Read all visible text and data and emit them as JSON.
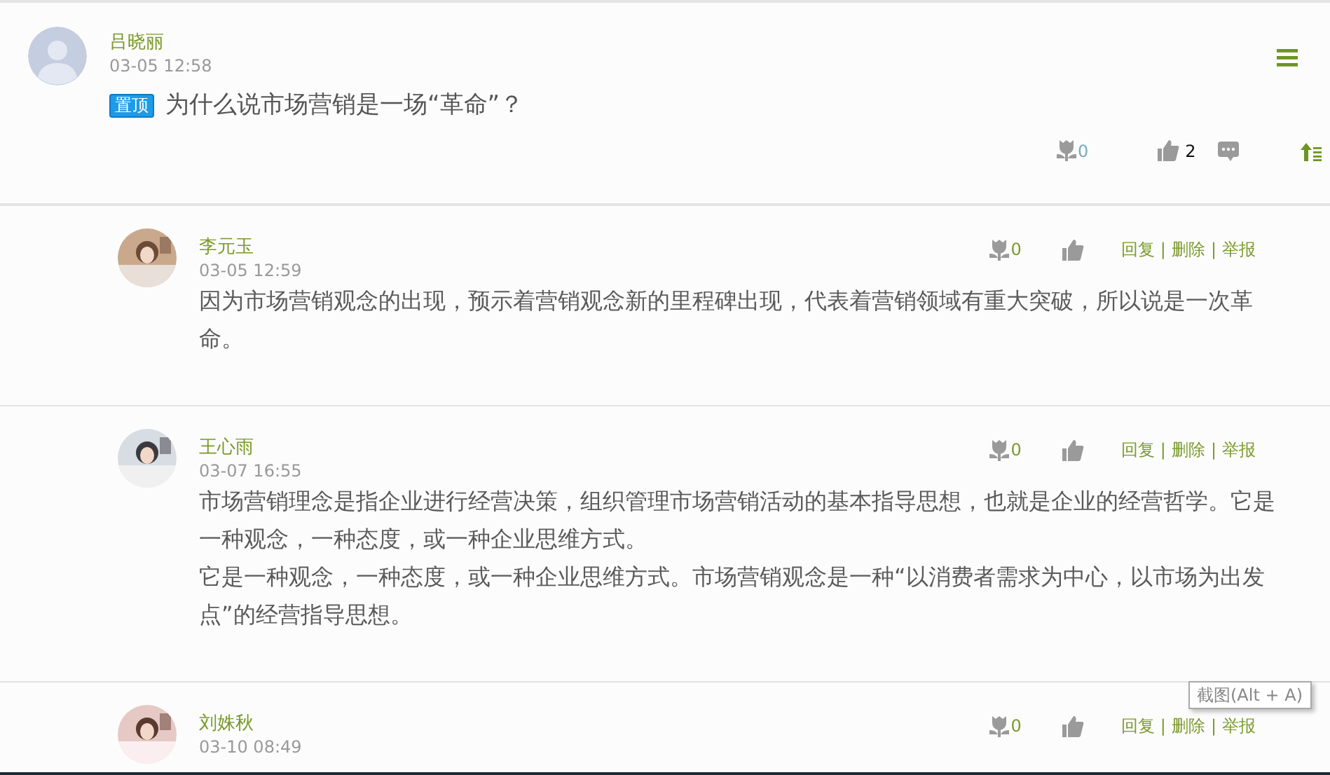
{
  "post": {
    "author": "吕晓丽",
    "time": "03-05 12:58",
    "tag": "置顶",
    "title": "为什么说市场营销是一场“革命”？",
    "flowers": "0",
    "likes": "2"
  },
  "replies": [
    {
      "author": "李元玉",
      "time": "03-05 12:59",
      "flowers": "0",
      "links": [
        {
          "kind": "link",
          "text": "回复"
        },
        {
          "kind": "separator",
          "text": "|"
        },
        {
          "kind": "link",
          "text": "删除"
        },
        {
          "kind": "separator",
          "text": "|"
        },
        {
          "kind": "link",
          "text": "举报"
        }
      ],
      "paragraphs": [
        "因为市场营销观念的出现，预示着营销观念新的里程碑出现，代表着营销领域有重大突破，所以说是一次革命。"
      ]
    },
    {
      "author": "王心雨",
      "time": "03-07 16:55",
      "flowers": "0",
      "links": [
        {
          "kind": "link",
          "text": "回复"
        },
        {
          "kind": "separator",
          "text": "|"
        },
        {
          "kind": "link",
          "text": "删除"
        },
        {
          "kind": "separator",
          "text": "|"
        },
        {
          "kind": "link",
          "text": "举报"
        }
      ],
      "paragraphs": [
        "市场营销理念是指企业进行经营决策，组织管理市场营销活动的基本指导思想，也就是企业的经营哲学。它是一种观念，一种态度，或一种企业思维方式。",
        "它是一种观念，一种态度，或一种企业思维方式。市场营销观念是一种“以消费者需求为中心，以市场为出发点”的经营指导思想。"
      ]
    },
    {
      "author": "刘姝秋",
      "time": "03-10 08:49",
      "flowers": "0",
      "links": [
        {
          "kind": "link",
          "text": "回复"
        },
        {
          "kind": "separator",
          "text": "|"
        },
        {
          "kind": "link",
          "text": "删除"
        },
        {
          "kind": "separator",
          "text": "|"
        },
        {
          "kind": "link",
          "text": "举报"
        }
      ]
    }
  ],
  "tooltip": "截图(Alt + A)"
}
